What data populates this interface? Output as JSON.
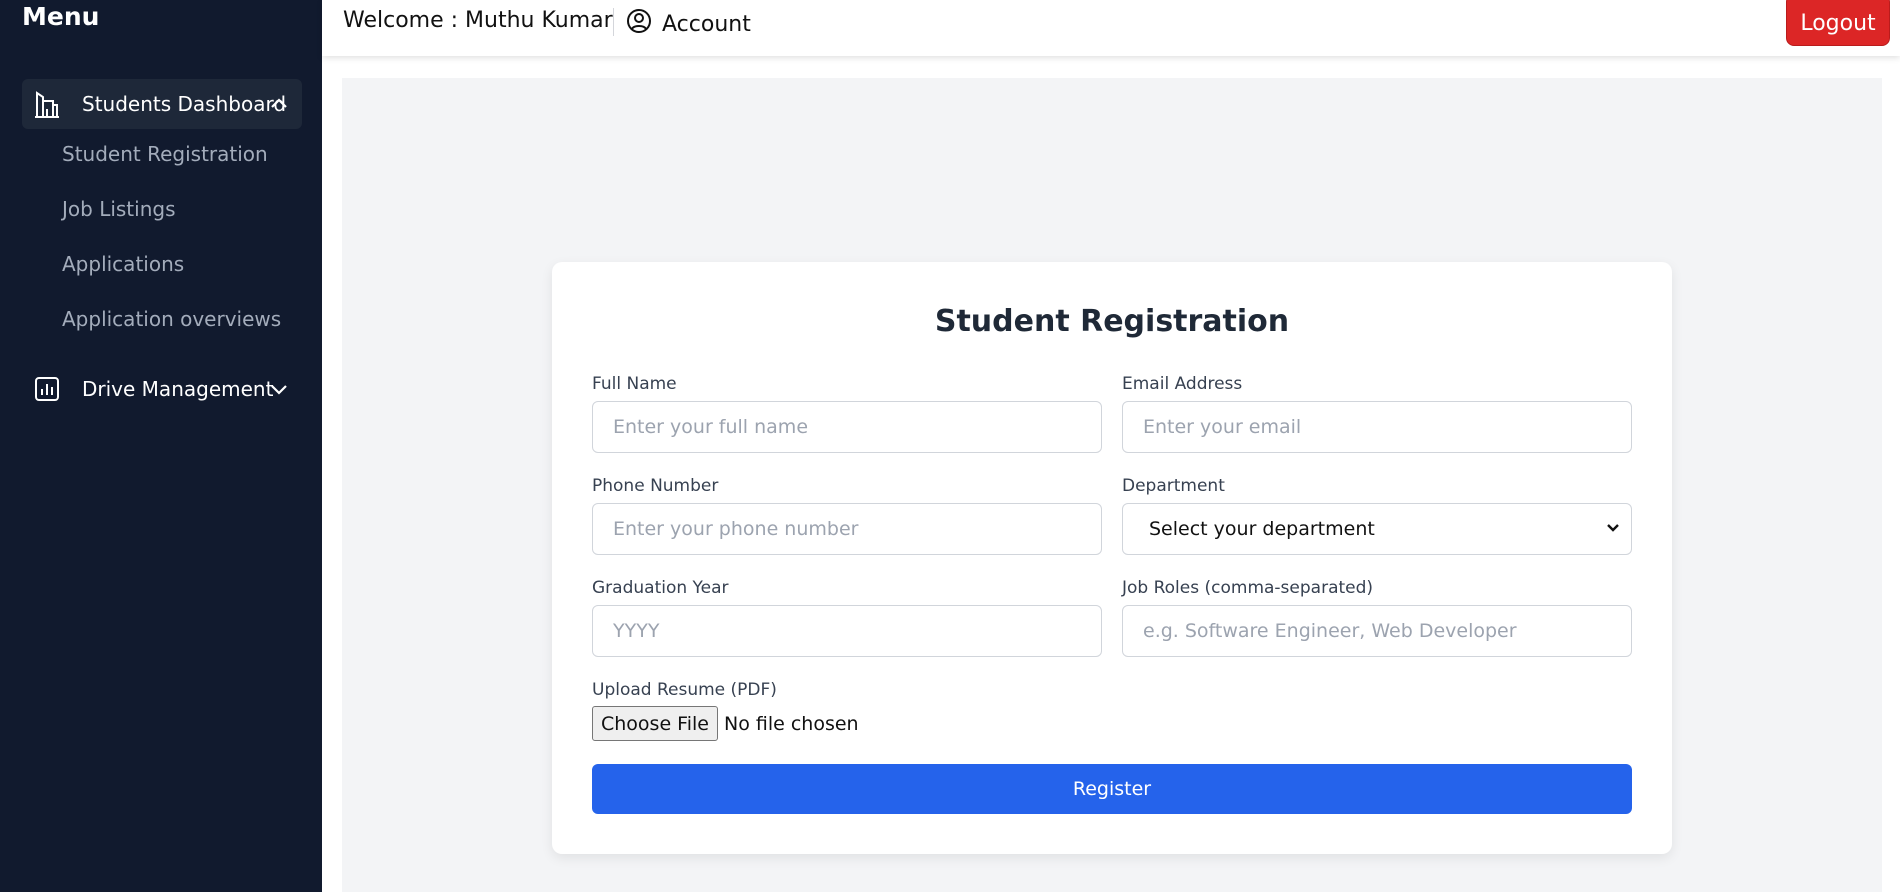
{
  "sidebar": {
    "title": "Menu",
    "groups": [
      {
        "label": "Students Dashboard",
        "icon": "building-chart-icon",
        "expanded": true
      },
      {
        "label": "Drive Management",
        "icon": "bar-chart-icon",
        "expanded": false
      }
    ],
    "sub_items": [
      "Student Registration",
      "Job Listings",
      "Applications",
      "Application overviews"
    ]
  },
  "header": {
    "welcome": "Welcome : Muthu Kumar",
    "account_label": "Account",
    "logout_label": "Logout"
  },
  "form": {
    "title": "Student Registration",
    "full_name": {
      "label": "Full Name",
      "placeholder": "Enter your full name"
    },
    "email": {
      "label": "Email Address",
      "placeholder": "Enter your email"
    },
    "phone": {
      "label": "Phone Number",
      "placeholder": "Enter your phone number"
    },
    "department": {
      "label": "Department",
      "selected": "Select your department"
    },
    "grad_year": {
      "label": "Graduation Year",
      "placeholder": "YYYY"
    },
    "job_roles": {
      "label": "Job Roles (comma-separated)",
      "placeholder": "e.g. Software Engineer, Web Developer"
    },
    "resume": {
      "label": "Upload Resume (PDF)",
      "button": "Choose File",
      "status": "No file chosen"
    },
    "submit_label": "Register"
  },
  "colors": {
    "sidebar_bg": "#111a2e",
    "accent": "#2563eb",
    "logout": "#dc2626"
  }
}
